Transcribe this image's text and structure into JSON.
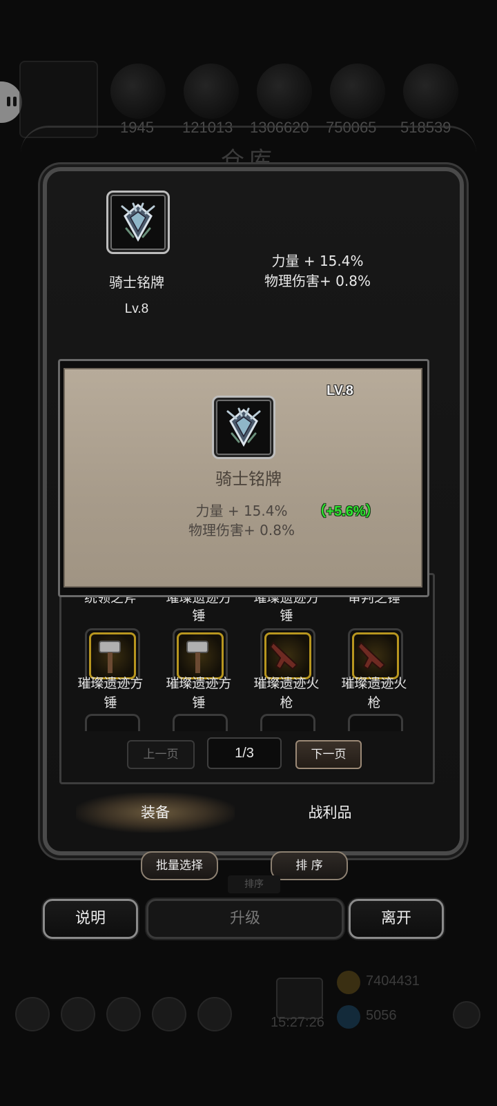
{
  "background": {
    "resource_counts": [
      "1945",
      "121013",
      "1306620",
      "750065",
      "518539"
    ],
    "title": "仓库",
    "ghost_sort_label": "排序",
    "gold_amount": "7404431",
    "gem_amount": "5056",
    "clock": "15:27:26"
  },
  "equipped": {
    "name": "骑士铭牌",
    "level": "Lv.8",
    "stats": [
      "力量 + 15.4%",
      "物理伤害+ 0.8%"
    ],
    "icon": "knight-badge-icon"
  },
  "tooltip": {
    "level": "LV.8",
    "name": "骑士铭牌",
    "stats": [
      "力量 + 15.4%",
      "物理伤害+ 0.8%"
    ],
    "bonus": "（+5.6%）",
    "bonus_color": "#2ee62e"
  },
  "grid": {
    "partial_labels": [
      "统领之斧",
      "璀璨遗迹方",
      "璀璨遗迹方",
      "审判之锤"
    ],
    "partial_labels_line2": [
      "",
      "锤",
      "锤",
      ""
    ],
    "items": [
      {
        "line1": "璀璨遗迹方",
        "line2": "锤",
        "icon": "hammer-icon"
      },
      {
        "line1": "璀璨遗迹方",
        "line2": "锤",
        "icon": "hammer-icon"
      },
      {
        "line1": "璀璨遗迹火",
        "line2": "枪",
        "icon": "gun-icon"
      },
      {
        "line1": "璀璨遗迹火",
        "line2": "枪",
        "icon": "gun-icon"
      }
    ]
  },
  "pager": {
    "prev": "上一页",
    "current": "1/3",
    "next": "下一页"
  },
  "tabs": {
    "equip": "装备",
    "loot": "战利品"
  },
  "actions": {
    "batch_select": "批量选择",
    "sort": "排 序",
    "help": "说明",
    "upgrade": "升级",
    "leave": "离开"
  },
  "colors": {
    "accent_gold": "#b8961f",
    "tooltip_bg": "#a89c8b",
    "bonus_green": "#2ee62e"
  }
}
